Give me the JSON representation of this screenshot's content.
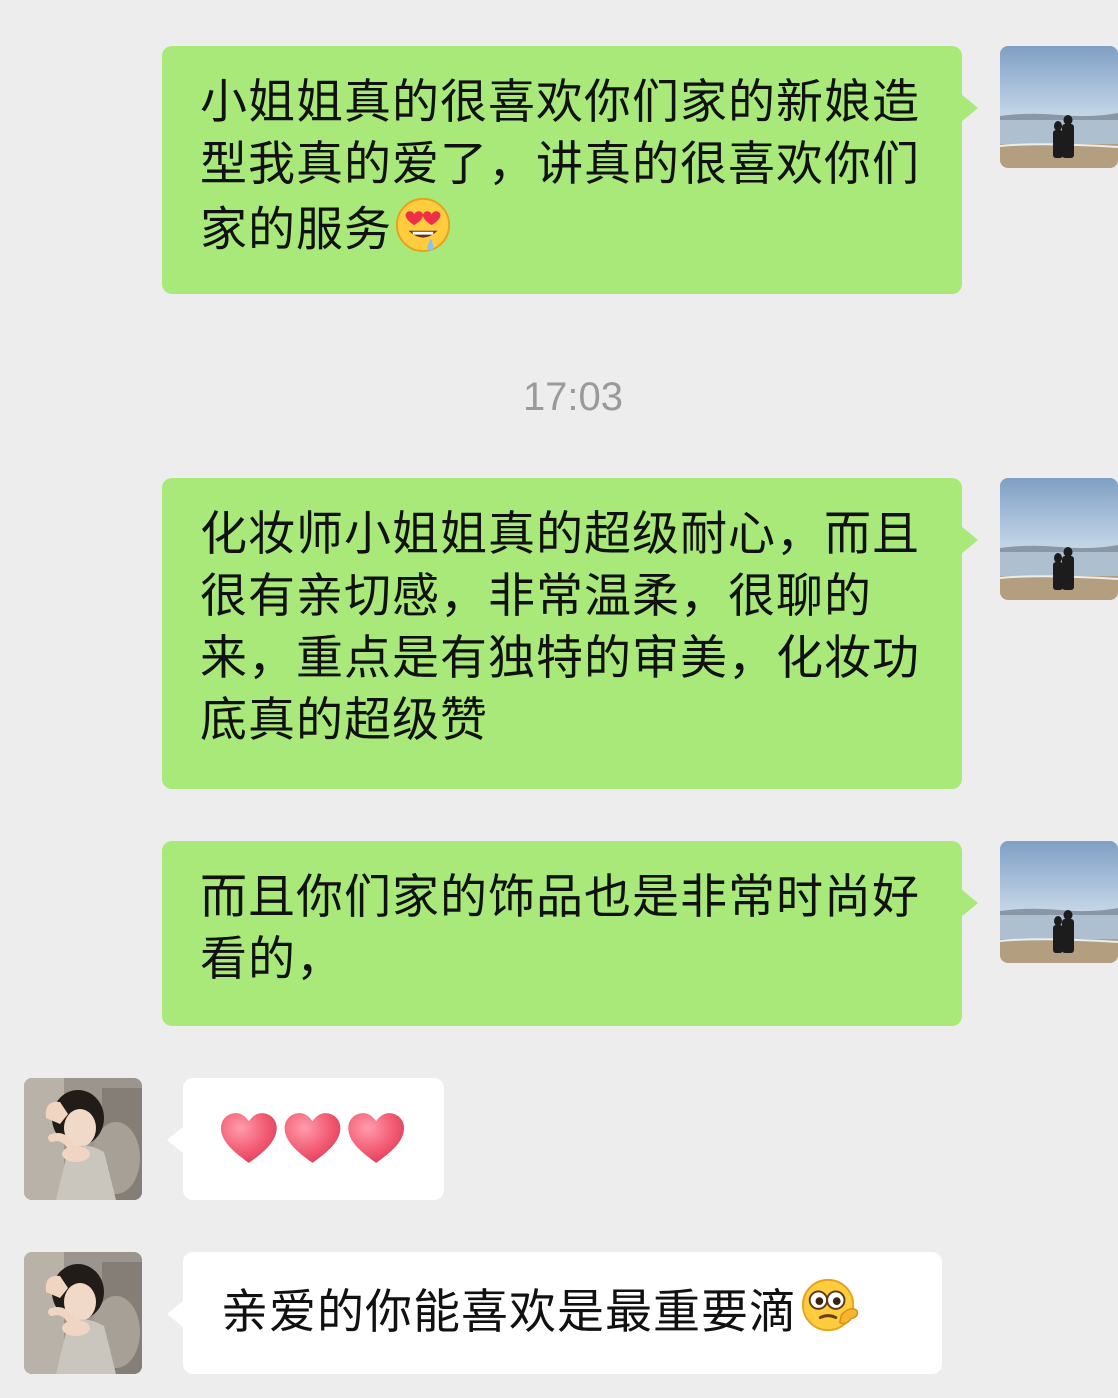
{
  "chat": {
    "timestamp": "17:03",
    "messages": [
      {
        "sender": "me",
        "text": "小姐姐真的很喜欢你们家的新娘造型我真的爱了，讲真的很喜欢你们家的服务",
        "trailing_emoji": "heart-eyes-drooling-emoji",
        "avatar": "couple-on-beach-photo"
      },
      {
        "sender": "me",
        "text": "化妆师小姐姐真的超级耐心，而且很有亲切感，非常温柔，很聊的来，重点是有独特的审美，化妆功底真的超级赞",
        "avatar": "couple-on-beach-photo"
      },
      {
        "sender": "me",
        "text": "而且你们家的饰品也是非常时尚好看的，",
        "avatar": "couple-on-beach-photo"
      },
      {
        "sender": "other",
        "emoji": [
          "red-heart-emoji",
          "red-heart-emoji",
          "red-heart-emoji"
        ],
        "avatar": "woman-portrait-photo"
      },
      {
        "sender": "other",
        "text": "亲爱的你能喜欢是最重要滴",
        "trailing_emoji": "thinking-monocle-face-emoji",
        "avatar": "woman-portrait-photo"
      }
    ]
  },
  "colors": {
    "background": "#ededed",
    "my_bubble": "#a9e97a",
    "their_bubble": "#ffffff",
    "timestamp_text": "#9a9a9a"
  }
}
